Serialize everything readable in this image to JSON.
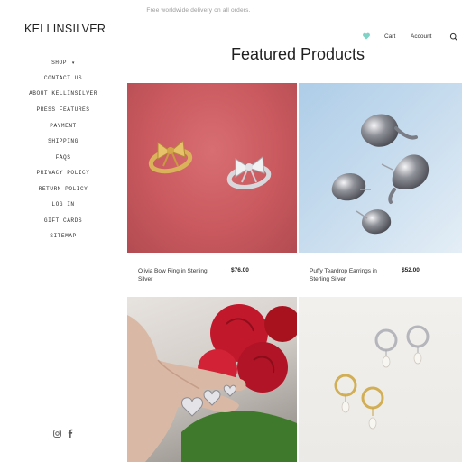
{
  "announcement": "Free worldwide delivery on all orders.",
  "brand": {
    "logo": "KELLINSILVER"
  },
  "header": {
    "cart_label": "Cart",
    "account_label": "Account",
    "icons": [
      "heart-icon",
      "search-icon"
    ],
    "accent_color": "#7fd3c6"
  },
  "sidebar": {
    "items": [
      {
        "label": "SHOP",
        "has_dropdown": true
      },
      {
        "label": "CONTACT US"
      },
      {
        "label": "ABOUT KELLINSILVER"
      },
      {
        "label": "PRESS FEATURES"
      },
      {
        "label": "PAYMENT"
      },
      {
        "label": "SHIPPING"
      },
      {
        "label": "FAQS"
      },
      {
        "label": "PRIVACY POLICY"
      },
      {
        "label": "RETURN POLICY"
      },
      {
        "label": "LOG IN"
      },
      {
        "label": "GIFT CARDS"
      },
      {
        "label": "SITEMAP"
      }
    ],
    "social_icons": [
      "instagram-icon",
      "facebook-icon"
    ]
  },
  "main": {
    "title": "Featured Products",
    "products": [
      {
        "name": "Olivia Bow Ring in Sterling Silver",
        "price": "$76.00",
        "image": "bow-rings-photo"
      },
      {
        "name": "Puffy Teardrop Earrings in Sterling Silver",
        "price": "$52.00",
        "image": "teardrop-earrings-photo"
      },
      {
        "name": "",
        "price": "",
        "image": "heart-rings-photo"
      },
      {
        "name": "",
        "price": "",
        "image": "pearl-hoop-earrings-photo"
      }
    ]
  }
}
